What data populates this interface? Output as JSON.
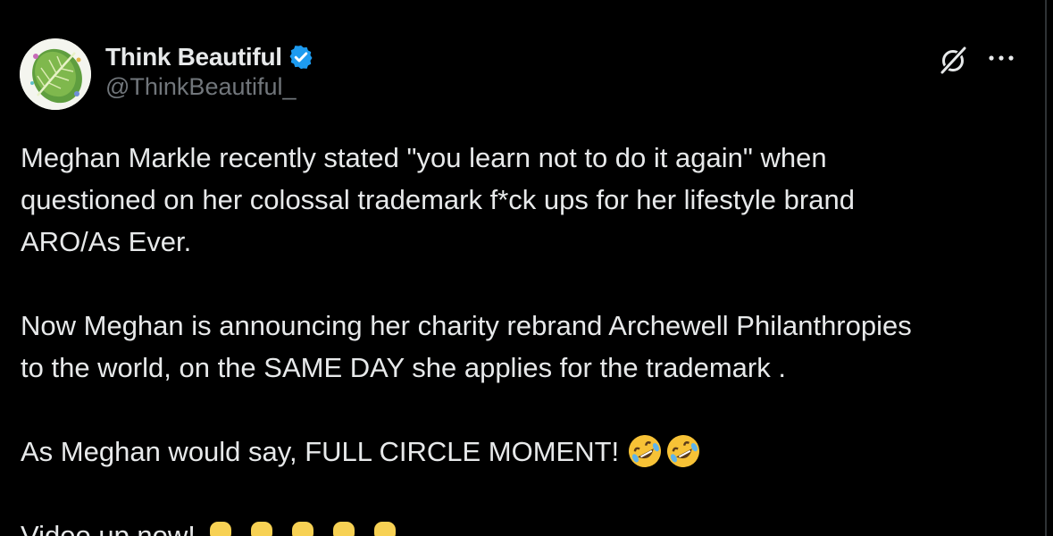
{
  "tweet": {
    "author": {
      "display_name": "Think Beautiful",
      "handle": "@ThinkBeautiful_",
      "verified": true,
      "avatar_icon": "leaf-avatar-icon"
    },
    "actions": {
      "grok_icon": "grok-icon",
      "more_icon": "more-options-icon"
    },
    "lines": [
      "Meghan Markle recently stated \"you learn not to do it again\" when",
      "questioned on her colossal trademark f*ck ups for her lifestyle brand",
      "ARO/As Ever.",
      "Now Meghan is announcing her charity rebrand Archewell Philanthropies",
      "to the world, on the SAME DAY she applies for the trademark .",
      "As Meghan would say, FULL CIRCLE MOMENT!",
      "Video up now!"
    ],
    "emojis": {
      "laugh": "rolling-on-floor-laughing-emoji",
      "point_down": "backhand-index-pointing-down-emoji"
    }
  },
  "colors": {
    "background": "#000000",
    "text_primary": "#e7e9ea",
    "text_secondary": "#71767b",
    "verified_blue": "#1d9bf0",
    "divider": "#2f3336"
  }
}
